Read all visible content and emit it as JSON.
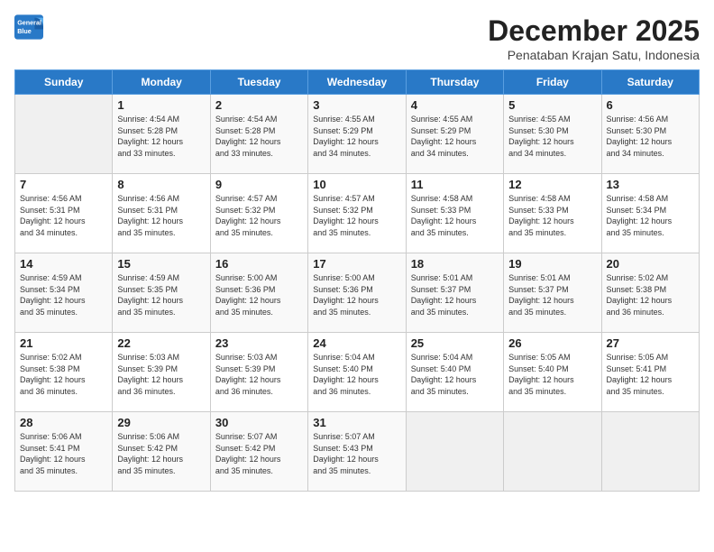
{
  "header": {
    "logo_line1": "General",
    "logo_line2": "Blue",
    "month_title": "December 2025",
    "subtitle": "Penataban Krajan Satu, Indonesia"
  },
  "days_of_week": [
    "Sunday",
    "Monday",
    "Tuesday",
    "Wednesday",
    "Thursday",
    "Friday",
    "Saturday"
  ],
  "weeks": [
    [
      {
        "day": "",
        "info": ""
      },
      {
        "day": "1",
        "info": "Sunrise: 4:54 AM\nSunset: 5:28 PM\nDaylight: 12 hours\nand 33 minutes."
      },
      {
        "day": "2",
        "info": "Sunrise: 4:54 AM\nSunset: 5:28 PM\nDaylight: 12 hours\nand 33 minutes."
      },
      {
        "day": "3",
        "info": "Sunrise: 4:55 AM\nSunset: 5:29 PM\nDaylight: 12 hours\nand 34 minutes."
      },
      {
        "day": "4",
        "info": "Sunrise: 4:55 AM\nSunset: 5:29 PM\nDaylight: 12 hours\nand 34 minutes."
      },
      {
        "day": "5",
        "info": "Sunrise: 4:55 AM\nSunset: 5:30 PM\nDaylight: 12 hours\nand 34 minutes."
      },
      {
        "day": "6",
        "info": "Sunrise: 4:56 AM\nSunset: 5:30 PM\nDaylight: 12 hours\nand 34 minutes."
      }
    ],
    [
      {
        "day": "7",
        "info": "Sunrise: 4:56 AM\nSunset: 5:31 PM\nDaylight: 12 hours\nand 34 minutes."
      },
      {
        "day": "8",
        "info": "Sunrise: 4:56 AM\nSunset: 5:31 PM\nDaylight: 12 hours\nand 35 minutes."
      },
      {
        "day": "9",
        "info": "Sunrise: 4:57 AM\nSunset: 5:32 PM\nDaylight: 12 hours\nand 35 minutes."
      },
      {
        "day": "10",
        "info": "Sunrise: 4:57 AM\nSunset: 5:32 PM\nDaylight: 12 hours\nand 35 minutes."
      },
      {
        "day": "11",
        "info": "Sunrise: 4:58 AM\nSunset: 5:33 PM\nDaylight: 12 hours\nand 35 minutes."
      },
      {
        "day": "12",
        "info": "Sunrise: 4:58 AM\nSunset: 5:33 PM\nDaylight: 12 hours\nand 35 minutes."
      },
      {
        "day": "13",
        "info": "Sunrise: 4:58 AM\nSunset: 5:34 PM\nDaylight: 12 hours\nand 35 minutes."
      }
    ],
    [
      {
        "day": "14",
        "info": "Sunrise: 4:59 AM\nSunset: 5:34 PM\nDaylight: 12 hours\nand 35 minutes."
      },
      {
        "day": "15",
        "info": "Sunrise: 4:59 AM\nSunset: 5:35 PM\nDaylight: 12 hours\nand 35 minutes."
      },
      {
        "day": "16",
        "info": "Sunrise: 5:00 AM\nSunset: 5:36 PM\nDaylight: 12 hours\nand 35 minutes."
      },
      {
        "day": "17",
        "info": "Sunrise: 5:00 AM\nSunset: 5:36 PM\nDaylight: 12 hours\nand 35 minutes."
      },
      {
        "day": "18",
        "info": "Sunrise: 5:01 AM\nSunset: 5:37 PM\nDaylight: 12 hours\nand 35 minutes."
      },
      {
        "day": "19",
        "info": "Sunrise: 5:01 AM\nSunset: 5:37 PM\nDaylight: 12 hours\nand 35 minutes."
      },
      {
        "day": "20",
        "info": "Sunrise: 5:02 AM\nSunset: 5:38 PM\nDaylight: 12 hours\nand 36 minutes."
      }
    ],
    [
      {
        "day": "21",
        "info": "Sunrise: 5:02 AM\nSunset: 5:38 PM\nDaylight: 12 hours\nand 36 minutes."
      },
      {
        "day": "22",
        "info": "Sunrise: 5:03 AM\nSunset: 5:39 PM\nDaylight: 12 hours\nand 36 minutes."
      },
      {
        "day": "23",
        "info": "Sunrise: 5:03 AM\nSunset: 5:39 PM\nDaylight: 12 hours\nand 36 minutes."
      },
      {
        "day": "24",
        "info": "Sunrise: 5:04 AM\nSunset: 5:40 PM\nDaylight: 12 hours\nand 36 minutes."
      },
      {
        "day": "25",
        "info": "Sunrise: 5:04 AM\nSunset: 5:40 PM\nDaylight: 12 hours\nand 35 minutes."
      },
      {
        "day": "26",
        "info": "Sunrise: 5:05 AM\nSunset: 5:40 PM\nDaylight: 12 hours\nand 35 minutes."
      },
      {
        "day": "27",
        "info": "Sunrise: 5:05 AM\nSunset: 5:41 PM\nDaylight: 12 hours\nand 35 minutes."
      }
    ],
    [
      {
        "day": "28",
        "info": "Sunrise: 5:06 AM\nSunset: 5:41 PM\nDaylight: 12 hours\nand 35 minutes."
      },
      {
        "day": "29",
        "info": "Sunrise: 5:06 AM\nSunset: 5:42 PM\nDaylight: 12 hours\nand 35 minutes."
      },
      {
        "day": "30",
        "info": "Sunrise: 5:07 AM\nSunset: 5:42 PM\nDaylight: 12 hours\nand 35 minutes."
      },
      {
        "day": "31",
        "info": "Sunrise: 5:07 AM\nSunset: 5:43 PM\nDaylight: 12 hours\nand 35 minutes."
      },
      {
        "day": "",
        "info": ""
      },
      {
        "day": "",
        "info": ""
      },
      {
        "day": "",
        "info": ""
      }
    ]
  ]
}
